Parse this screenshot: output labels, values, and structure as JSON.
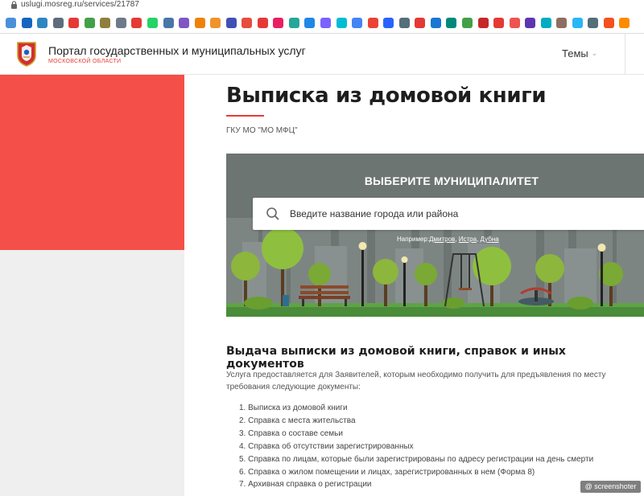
{
  "browser": {
    "url": "uslugi.mosreg.ru/services/21787",
    "bookmarks": [
      {
        "icon": "bookmark-icon",
        "color": "#4a90d9"
      },
      {
        "icon": "bookmark-icon",
        "color": "#1565c0"
      },
      {
        "icon": "bookmark-icon",
        "color": "#2e86c1"
      },
      {
        "icon": "bookmark-icon",
        "color": "#5d6d7e"
      },
      {
        "icon": "bookmark-icon",
        "color": "#e53935"
      },
      {
        "icon": "bookmark-icon",
        "color": "#43a047"
      },
      {
        "icon": "bookmark-icon",
        "color": "#8e7f3c"
      },
      {
        "icon": "bookmark-icon",
        "color": "#6c7a89"
      },
      {
        "icon": "bookmark-icon",
        "color": "#e53935"
      },
      {
        "icon": "bookmark-icon",
        "color": "#25d366"
      },
      {
        "icon": "bookmark-icon",
        "color": "#4a76a8"
      },
      {
        "icon": "bookmark-icon",
        "color": "#7e57c2"
      },
      {
        "icon": "bookmark-icon",
        "color": "#ee8208"
      },
      {
        "icon": "bookmark-icon",
        "color": "#f0932b"
      },
      {
        "icon": "bookmark-icon",
        "color": "#3f51b5"
      },
      {
        "icon": "bookmark-icon",
        "color": "#e74c3c"
      },
      {
        "icon": "bookmark-icon",
        "color": "#e53935"
      },
      {
        "icon": "bookmark-icon",
        "color": "#e91e63"
      },
      {
        "icon": "bookmark-icon",
        "color": "#26a69a"
      },
      {
        "icon": "bookmark-icon",
        "color": "#1e88e5"
      },
      {
        "icon": "bookmark-icon",
        "color": "#7b61ff"
      },
      {
        "icon": "bookmark-icon",
        "color": "#00bcd4"
      },
      {
        "icon": "bookmark-icon",
        "color": "#4285f4"
      },
      {
        "icon": "bookmark-icon",
        "color": "#ea4335"
      },
      {
        "icon": "bookmark-icon",
        "color": "#2962ff"
      },
      {
        "icon": "bookmark-icon",
        "color": "#546e7a"
      },
      {
        "icon": "bookmark-icon",
        "color": "#e53935"
      },
      {
        "icon": "bookmark-icon",
        "color": "#1976d2"
      },
      {
        "icon": "bookmark-icon",
        "color": "#00897b"
      },
      {
        "icon": "bookmark-icon",
        "color": "#43a047"
      },
      {
        "icon": "bookmark-icon",
        "color": "#c62828"
      },
      {
        "icon": "bookmark-icon",
        "color": "#e53935"
      },
      {
        "icon": "bookmark-icon",
        "color": "#ef5350"
      },
      {
        "icon": "bookmark-icon",
        "color": "#5e35b1"
      },
      {
        "icon": "bookmark-icon",
        "color": "#00acc1"
      },
      {
        "icon": "bookmark-icon",
        "color": "#8d6e63"
      },
      {
        "icon": "bookmark-icon",
        "color": "#29b6f6"
      },
      {
        "icon": "bookmark-icon",
        "color": "#546e7a"
      },
      {
        "icon": "bookmark-icon",
        "color": "#f4511e"
      },
      {
        "icon": "bookmark-icon",
        "color": "#fb8c00"
      }
    ]
  },
  "header": {
    "portal_title": "Портал государственных и муниципальных услуг",
    "portal_subtitle": "МОСКОВСКОЙ ОБЛАСТИ",
    "themes_label": "Темы",
    "accent_color": "#e63c33"
  },
  "main": {
    "title": "Выписка из домовой книги",
    "organization": "ГКУ МО \"МО МФЦ\"",
    "municipality": {
      "heading": "ВЫБЕРИТЕ МУНИЦИПАЛИТЕТ",
      "search_placeholder": "Введите название города или района",
      "examples_prefix": "Например:",
      "examples": [
        "Дмитров",
        "Истра",
        "Дубна"
      ]
    },
    "section_heading": "Выдача выписки из домовой книги, справок и иных документов",
    "intro": "Услуга предоставляется для Заявителей, которым необходимо получить для предъявления по месту требования следующие документы:",
    "documents": [
      "1. Выписка из домовой книги",
      "2. Справка с места жительства",
      "3. Справка о составе семьи",
      "4. Справка об отсутствии зарегистрированных",
      "5. Справка по лицам, которые были зарегистрированы по адресу регистрации на день смерти",
      "6. Справка о жилом помещении и лицах, зарегистрированных в нем (Форма 8)",
      "7. Архивная справка о регистрации"
    ]
  },
  "watermark": "@ screenshoter"
}
